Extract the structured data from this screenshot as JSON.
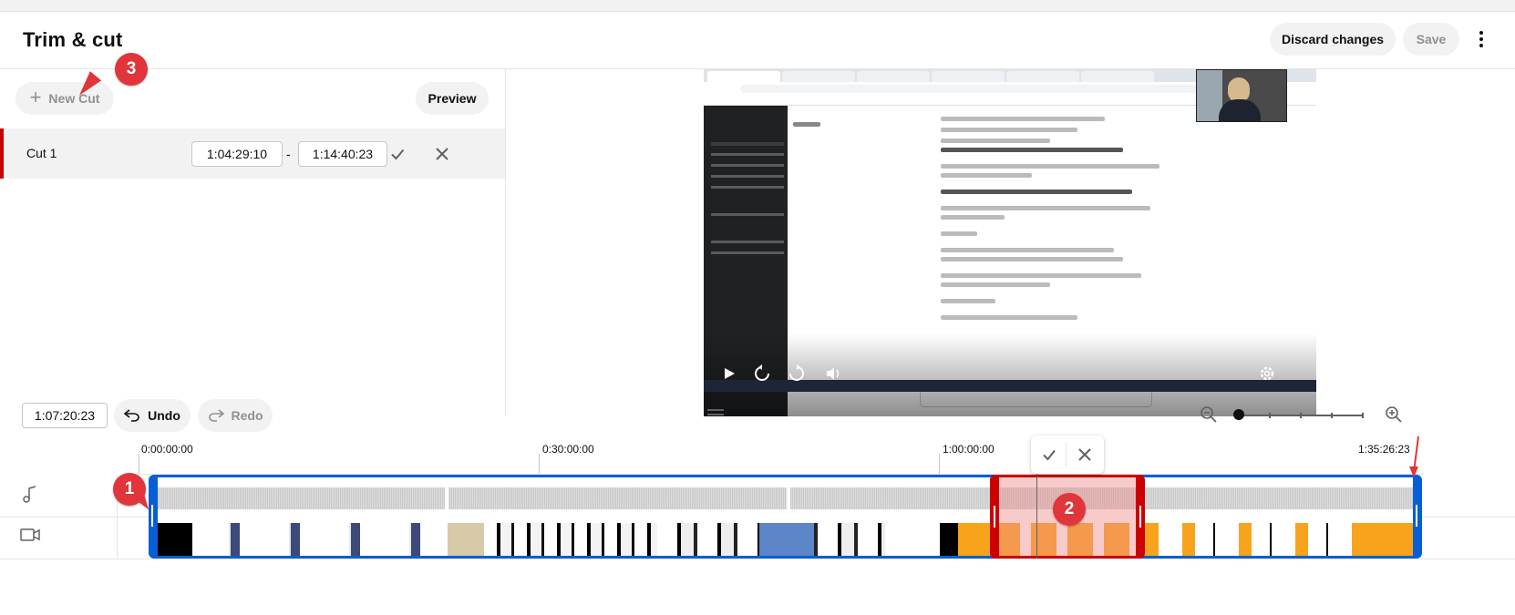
{
  "header": {
    "title": "Trim & cut",
    "discard_label": "Discard changes",
    "save_label": "Save"
  },
  "left_panel": {
    "new_cut_label": "New Cut",
    "preview_label": "Preview",
    "cut": {
      "label": "Cut 1",
      "start": "1:04:29:10",
      "separator": "-",
      "end": "1:14:40:23"
    }
  },
  "toolbar": {
    "current_time": "1:07:20:23",
    "undo_label": "Undo",
    "redo_label": "Redo"
  },
  "ruler": {
    "labels": [
      "0:00:00:00",
      "0:30:00:00",
      "1:00:00:00",
      "1:35:26:23"
    ]
  },
  "annotations": {
    "badge_1": "1",
    "badge_2": "2",
    "badge_3": "3"
  },
  "colors": {
    "accent_blue": "#065fd4",
    "cut_red": "#cc0000",
    "badge_red": "#e0353a"
  },
  "zoom": {
    "level": 0
  }
}
